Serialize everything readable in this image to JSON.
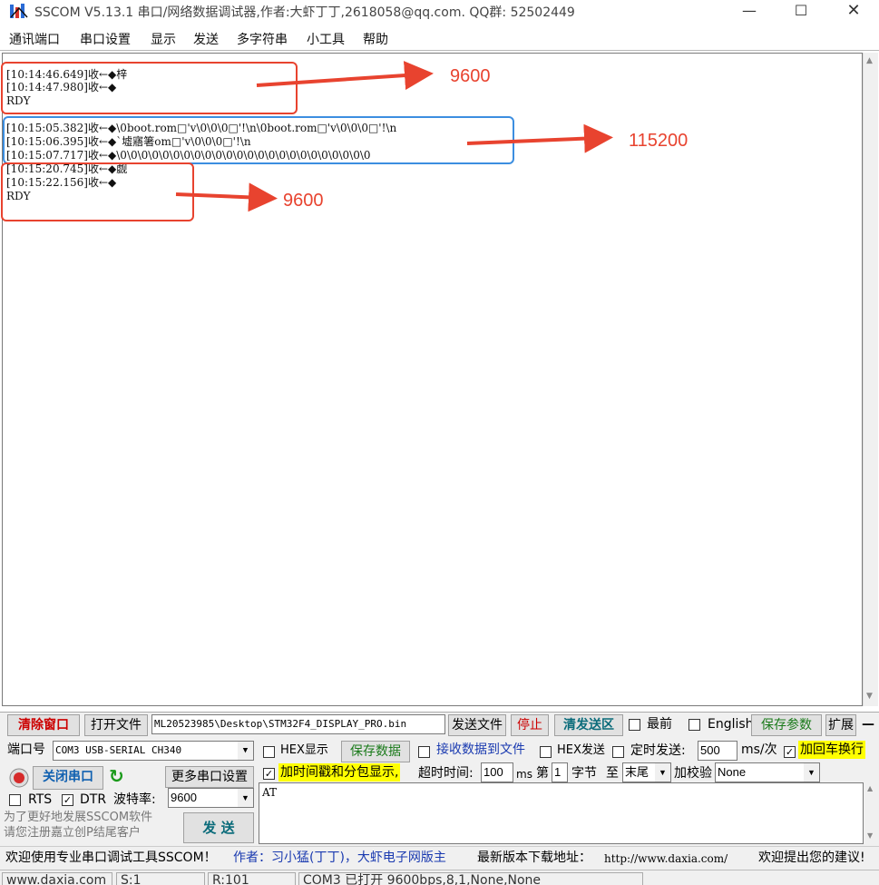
{
  "window": {
    "title": "SSCOM V5.13.1 串口/网络数据调试器,作者:大虾丁丁,2618058@qq.com. QQ群:  52502449",
    "min": "—",
    "max": "☐",
    "close": "✕"
  },
  "menu": [
    "通讯端口",
    "串口设置",
    "显示",
    "发送",
    "多字符串",
    "小工具",
    "帮助"
  ],
  "receive_lines": [
    "[10:14:46.649]收←◆梓",
    "[10:14:47.980]收←◆",
    "RDY",
    "[10:15:05.382]收←◆\\0boot.rom□'v\\0\\0\\0□'!\\n\\0boot.rom□'v\\0\\0\\0□'!\\n",
    "[10:15:06.395]收←◆`墟寤箸om□'v\\0\\0\\0□'!\\n",
    "[10:15:07.717]收←◆\\0\\0\\0\\0\\0\\0\\0\\0\\0\\0\\0\\0\\0\\0\\0\\0\\0\\0\\0\\0\\0\\0\\0\\0",
    "[10:15:20.745]收←◆觑",
    "[10:15:22.156]收←◆",
    "RDY"
  ],
  "annotations": {
    "note1": "9600",
    "note2": "115200",
    "note3": "9600",
    "colors": {
      "red": "#e8432f",
      "blue": "#3c8ee0"
    }
  },
  "toolbar": {
    "clear_window": "清除窗口",
    "open_file": "打开文件",
    "file_path": "ML20523985\\Desktop\\STM32F4_DISPLAY_PRO.bin",
    "send_file": "发送文件",
    "stop": "停止",
    "clear_send": "清发送区",
    "topmost": "最前",
    "english": "English",
    "save_params": "保存参数",
    "expand": "扩展",
    "dash": "—"
  },
  "port": {
    "port_label": "端口号",
    "port_value": "COM3 USB-SERIAL CH340",
    "close_port": "关闭串口",
    "more_settings": "更多串口设置",
    "rts": "RTS",
    "dtr": "DTR",
    "baud_label": "波特率:",
    "baud_value": "9600"
  },
  "options": {
    "hex_display": "HEX显示",
    "save_data": "保存数据",
    "recv_to_file": "接收数据到文件",
    "hex_send": "HEX发送",
    "timed_send": "定时发送:",
    "interval": "500",
    "ms_per": "ms/次",
    "add_crlf": "加回车换行",
    "timestamp": "加时间戳和分包显示,",
    "timeout_label": "超时时间:",
    "timeout_value": "100",
    "ms": "ms",
    "di": "第",
    "byte_from": "1",
    "byte_label": "字节",
    "to": "至",
    "to_value": "末尾",
    "checksum_label": "加校验",
    "checksum_value": "None",
    "yellow": "#ffff00"
  },
  "send": {
    "text": "AT",
    "button": "发 送",
    "promo1": "为了更好地发展SSCOM软件",
    "promo2": "请您注册嘉立创P结尾客户"
  },
  "promo_bar": {
    "welcome": "欢迎使用专业串口调试工具SSCOM！",
    "author": "作者：习小猛(丁丁)，大虾电子网版主",
    "download": "最新版本下载地址：",
    "url": "http://www.daxia.com/",
    "feedback": "欢迎提出您的建议!"
  },
  "status": {
    "site": "www.daxia.com",
    "sent": "S:1",
    "received": "R:101",
    "port_status": "COM3 已打开  9600bps,8,1,None,None"
  }
}
